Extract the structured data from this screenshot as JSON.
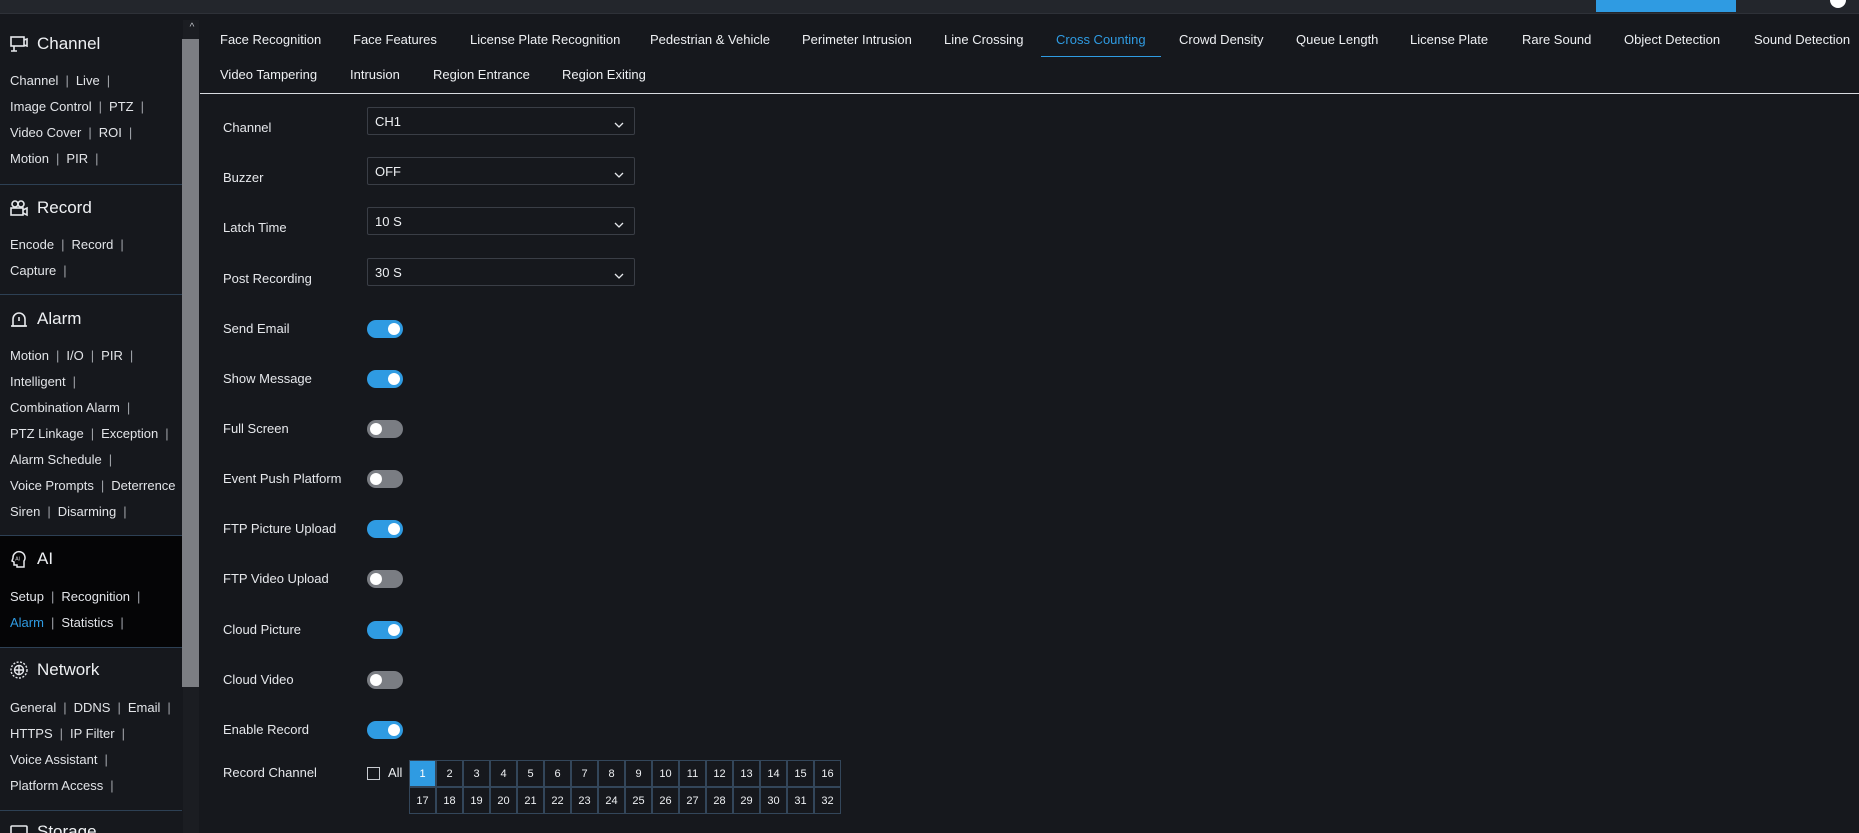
{
  "colors": {
    "accent": "#2f9be2",
    "background": "#16181d",
    "toggle_off": "#7a7d83"
  },
  "sidebar": {
    "sections": [
      {
        "title": "Channel",
        "icon": "channel-icon",
        "rows": [
          [
            "Channel",
            "Live"
          ],
          [
            "Image Control",
            "PTZ"
          ],
          [
            "Video Cover",
            "ROI"
          ],
          [
            "Motion",
            "PIR"
          ]
        ]
      },
      {
        "title": "Record",
        "icon": "record-icon",
        "rows": [
          [
            "Encode",
            "Record"
          ],
          [
            "Capture"
          ]
        ]
      },
      {
        "title": "Alarm",
        "icon": "alarm-icon",
        "rows": [
          [
            "Motion",
            "I/O",
            "PIR"
          ],
          [
            "Intelligent"
          ],
          [
            "Combination Alarm"
          ],
          [
            "PTZ Linkage",
            "Exception"
          ],
          [
            "Alarm Schedule"
          ],
          [
            "Voice Prompts",
            "Deterrence"
          ],
          [
            "Siren",
            "Disarming"
          ]
        ]
      },
      {
        "title": "AI",
        "icon": "ai-icon",
        "rows": [
          [
            "Setup",
            "Recognition"
          ],
          [
            "Alarm",
            "Statistics"
          ]
        ],
        "active_item": "Alarm"
      },
      {
        "title": "Network",
        "icon": "network-icon",
        "rows": [
          [
            "General",
            "DDNS",
            "Email"
          ],
          [
            "HTTPS",
            "IP Filter"
          ],
          [
            "Voice Assistant"
          ],
          [
            "Platform Access"
          ]
        ]
      },
      {
        "title": "Storage",
        "icon": "storage-icon",
        "rows": []
      }
    ]
  },
  "tabs": {
    "row1": [
      "Face Recognition",
      "Face Features",
      "License Plate Recognition",
      "Pedestrian & Vehicle",
      "Perimeter Intrusion",
      "Line Crossing",
      "Cross Counting",
      "Crowd Density",
      "Queue Length",
      "License Plate",
      "Rare Sound",
      "Object Detection",
      "Sound Detection"
    ],
    "row2": [
      "Video Tampering",
      "Intrusion",
      "Region Entrance",
      "Region Exiting"
    ],
    "active": "Cross Counting"
  },
  "form": {
    "selects": [
      {
        "label": "Channel",
        "value": "CH1"
      },
      {
        "label": "Buzzer",
        "value": "OFF"
      },
      {
        "label": "Latch Time",
        "value": "10 S"
      },
      {
        "label": "Post Recording",
        "value": "30 S"
      }
    ],
    "toggles": [
      {
        "label": "Send Email",
        "on": true
      },
      {
        "label": "Show Message",
        "on": true
      },
      {
        "label": "Full Screen",
        "on": false
      },
      {
        "label": "Event Push Platform",
        "on": false
      },
      {
        "label": "FTP Picture Upload",
        "on": true
      },
      {
        "label": "FTP Video Upload",
        "on": false
      },
      {
        "label": "Cloud Picture",
        "on": true
      },
      {
        "label": "Cloud Video",
        "on": false
      },
      {
        "label": "Enable Record",
        "on": true
      }
    ],
    "record_channel": {
      "label": "Record Channel",
      "all_label": "All",
      "all_checked": false,
      "channels": [
        "1",
        "2",
        "3",
        "4",
        "5",
        "6",
        "7",
        "8",
        "9",
        "10",
        "11",
        "12",
        "13",
        "14",
        "15",
        "16",
        "17",
        "18",
        "19",
        "20",
        "21",
        "22",
        "23",
        "24",
        "25",
        "26",
        "27",
        "28",
        "29",
        "30",
        "31",
        "32"
      ],
      "selected": [
        "1"
      ]
    }
  }
}
